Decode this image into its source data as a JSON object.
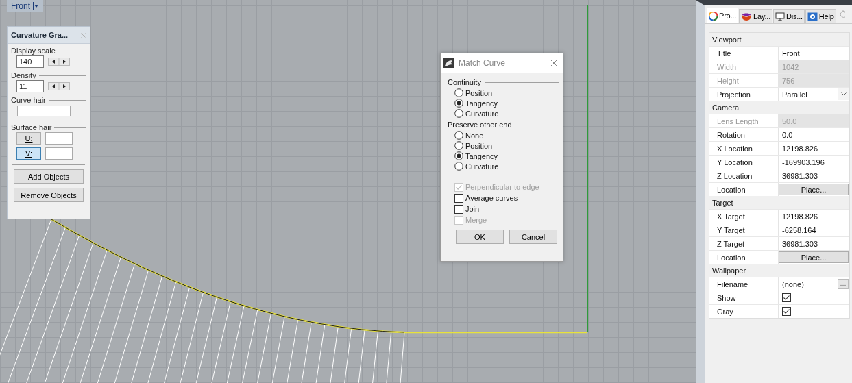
{
  "viewport": {
    "label": "Front"
  },
  "curvature_panel": {
    "title": "Curvature Gra...",
    "display_scale": {
      "label": "Display scale",
      "value": "140"
    },
    "density": {
      "label": "Density",
      "value": "11"
    },
    "curve_hair": {
      "label": "Curve hair"
    },
    "surface_hair": {
      "label": "Surface hair",
      "buttons": [
        {
          "label": "U:",
          "selected": false
        },
        {
          "label": "V:",
          "selected": true
        }
      ]
    },
    "buttons": [
      "Add Objects",
      "Remove Objects"
    ]
  },
  "match_curve": {
    "title": "Match Curve",
    "groups": [
      {
        "label": "Continuity",
        "options": [
          {
            "label": "Position",
            "selected": false
          },
          {
            "label": "Tangency",
            "selected": true
          },
          {
            "label": "Curvature",
            "selected": false
          }
        ]
      },
      {
        "label": "Preserve other end",
        "options": [
          {
            "label": "None",
            "selected": false
          },
          {
            "label": "Position",
            "selected": false
          },
          {
            "label": "Tangency",
            "selected": true
          },
          {
            "label": "Curvature",
            "selected": false
          }
        ]
      }
    ],
    "checkboxes": [
      {
        "label": "Perpendicular to edge",
        "checked": true,
        "disabled": true
      },
      {
        "label": "Average curves",
        "checked": false,
        "disabled": false
      },
      {
        "label": "Join",
        "checked": false,
        "disabled": false
      },
      {
        "label": "Merge",
        "checked": false,
        "disabled": true
      }
    ],
    "buttons": [
      "OK",
      "Cancel"
    ]
  },
  "properties": {
    "tabs": [
      {
        "label": "Pro...",
        "kind": "properties",
        "selected": true
      },
      {
        "label": "Lay...",
        "kind": "layers",
        "selected": false
      },
      {
        "label": "Dis...",
        "kind": "display",
        "selected": false
      },
      {
        "label": "Help",
        "kind": "help",
        "selected": false
      }
    ],
    "sections": [
      {
        "title": "Viewport",
        "rows": [
          {
            "kind": "text",
            "label": "Title",
            "value": "Front",
            "disabled": false
          },
          {
            "kind": "text",
            "label": "Width",
            "value": "1042",
            "disabled": true
          },
          {
            "kind": "text",
            "label": "Height",
            "value": "756",
            "disabled": true
          },
          {
            "kind": "dropdown",
            "label": "Projection",
            "value": "Parallel",
            "disabled": false
          }
        ]
      },
      {
        "title": "Camera",
        "rows": [
          {
            "kind": "text",
            "label": "Lens Length",
            "value": "50.0",
            "disabled": true
          },
          {
            "kind": "text",
            "label": "Rotation",
            "value": "0.0",
            "disabled": false
          },
          {
            "kind": "text",
            "label": "X Location",
            "value": "12198.826",
            "disabled": false
          },
          {
            "kind": "text",
            "label": "Y Location",
            "value": "-169903.196",
            "disabled": false
          },
          {
            "kind": "text",
            "label": "Z Location",
            "value": "36981.303",
            "disabled": false
          },
          {
            "kind": "button",
            "label": "Location",
            "value": "Place...",
            "disabled": false
          }
        ]
      },
      {
        "title": "Target",
        "rows": [
          {
            "kind": "text",
            "label": "X Target",
            "value": "12198.826",
            "disabled": false
          },
          {
            "kind": "text",
            "label": "Y Target",
            "value": "-6258.164",
            "disabled": false
          },
          {
            "kind": "text",
            "label": "Z Target",
            "value": "36981.303",
            "disabled": false
          },
          {
            "kind": "button",
            "label": "Location",
            "value": "Place...",
            "disabled": false
          }
        ]
      },
      {
        "title": "Wallpaper",
        "rows": [
          {
            "kind": "browse",
            "label": "Filename",
            "value": "(none)",
            "disabled": false
          },
          {
            "kind": "checkbox",
            "label": "Show",
            "checked": true,
            "disabled": false
          },
          {
            "kind": "checkbox",
            "label": "Gray",
            "checked": true,
            "disabled": false
          }
        ]
      }
    ]
  }
}
